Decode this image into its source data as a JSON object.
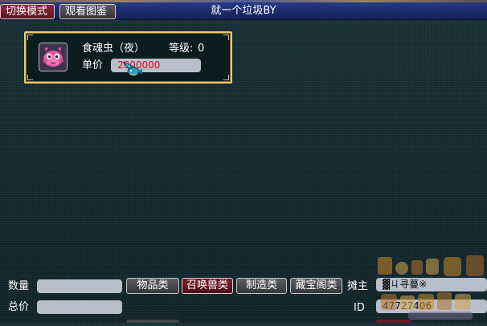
{
  "topbar": {
    "switch_mode": "切换模式",
    "view_atlas": "观看图鉴",
    "title": "就一个垃圾BY"
  },
  "listing": {
    "pet_name": "食魂虫（夜）",
    "level_label": "等级:",
    "level_value": "0",
    "price_label": "单价",
    "price_value": "2000000",
    "portrait_icon": "pink-bug-pet-icon"
  },
  "bottom": {
    "quantity_label": "数量",
    "quantity_value": "",
    "total_label": "总价",
    "total_value": "",
    "categories": [
      {
        "label": "物品类",
        "active": false
      },
      {
        "label": "召唤兽类",
        "active": true
      },
      {
        "label": "制造类",
        "active": false
      },
      {
        "label": "藏宝阁类",
        "active": false
      }
    ],
    "owner_label": "摊主",
    "owner_value": "▓ㄐ寻蔓※",
    "id_label": "ID",
    "id_value": "47727406"
  },
  "colors": {
    "card_border": "#e9c96b",
    "price_text": "#e01010",
    "active_tab": "#7a1f2c",
    "field_bg": "#b8bfcc"
  }
}
